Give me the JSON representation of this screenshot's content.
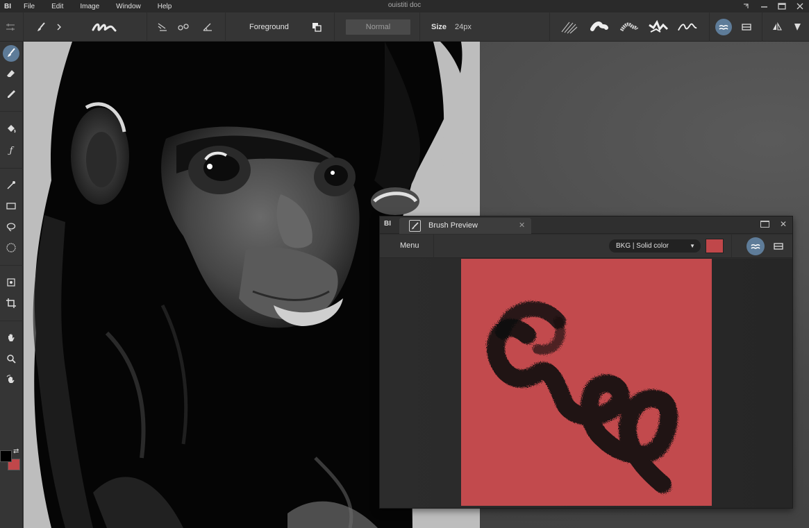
{
  "menubar": {
    "logo": "BI",
    "items": [
      "File",
      "Edit",
      "Image",
      "Window",
      "Help"
    ],
    "doc_title": "ouistiti doc"
  },
  "options": {
    "color_source": "Foreground",
    "blend_mode": "Normal",
    "size_label": "Size",
    "size_value": "24px"
  },
  "colors": {
    "foreground": "#000000",
    "background": "#c0474a",
    "accent": "#5e7c99",
    "preview_bkg": "#c24a4d"
  },
  "toolbox": {
    "tools": [
      "brush-icon",
      "eraser-icon",
      "eyedropper-icon",
      "bucket-icon",
      "filter-fx-icon",
      "gradient-icon",
      "rect-select-icon",
      "lasso-icon",
      "magic-select-icon",
      "transform-icon",
      "crop-icon",
      "hand-icon",
      "zoom-icon",
      "rotate-view-icon"
    ]
  },
  "brush_preview": {
    "logo": "BI",
    "tab_title": "Brush Preview",
    "menu_label": "Menu",
    "background_select": "BKG | Solid color"
  }
}
